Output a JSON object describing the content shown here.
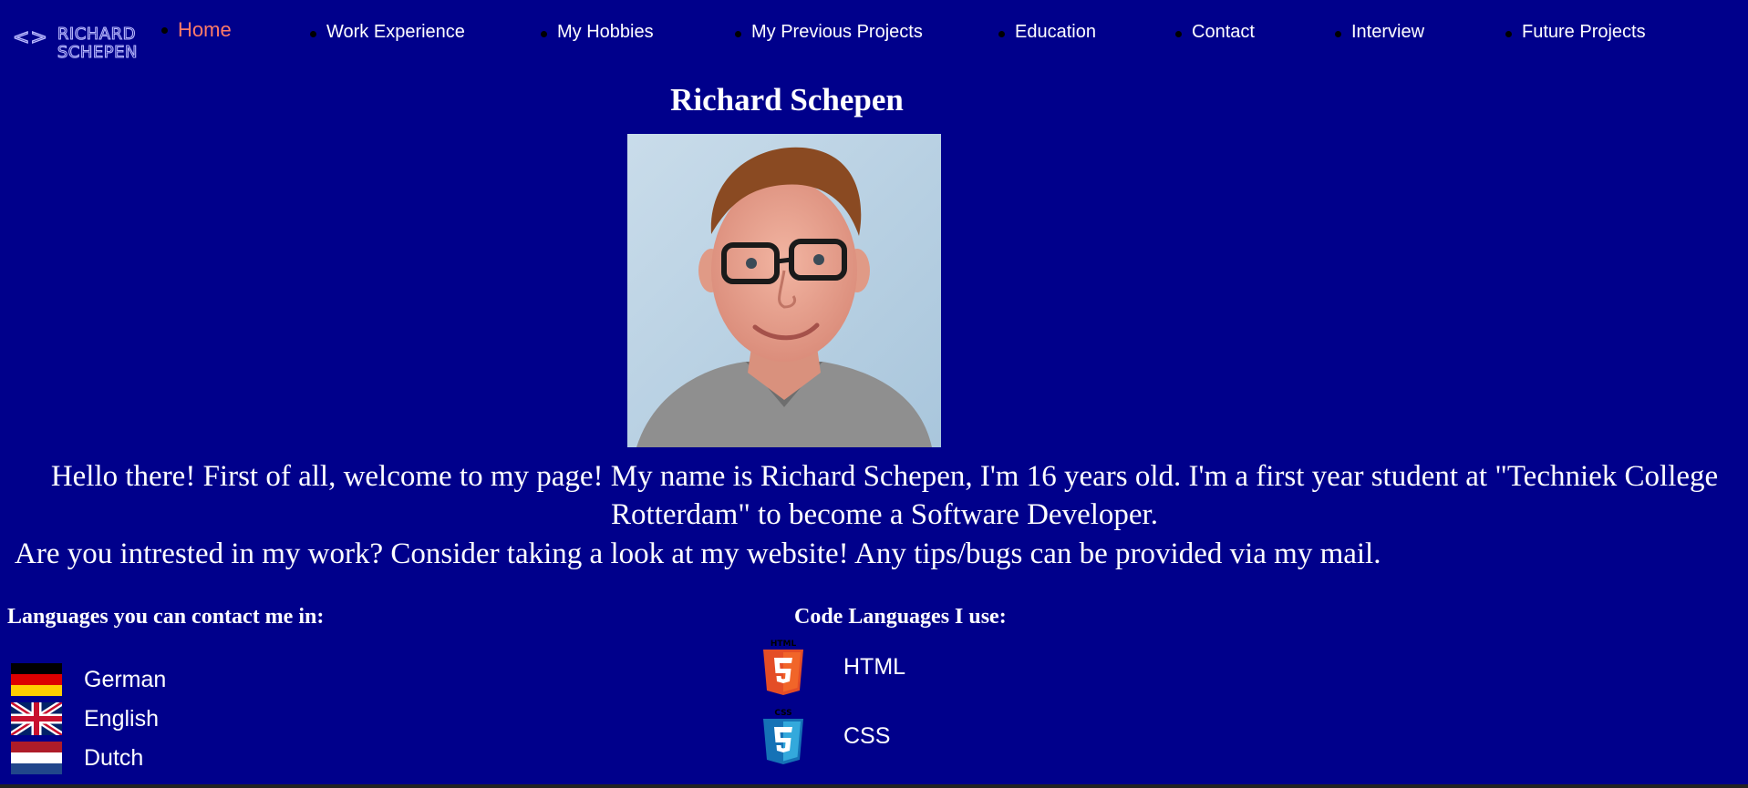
{
  "logo": {
    "code_symbol": "<>",
    "line1": "RICHARD",
    "line2": "SCHEPEN"
  },
  "nav": {
    "items": [
      {
        "label": "Home",
        "active": true
      },
      {
        "label": "Work Experience"
      },
      {
        "label": "My Hobbies"
      },
      {
        "label": "My Previous Projects"
      },
      {
        "label": "Education"
      },
      {
        "label": "Contact"
      },
      {
        "label": "Interview"
      },
      {
        "label": "Future Projects"
      }
    ]
  },
  "main": {
    "title": "Richard Schepen",
    "intro": "Hello there! First of all, welcome to my page! My name is Richard Schepen, I'm 16 years old. I'm a first year student at \"Techniek College Rotterdam\" to become a Software Developer.",
    "intro2": "Are you intrested in my work? Consider taking a look at my website! Any tips/bugs can be provided via my mail."
  },
  "languages": {
    "heading": "Languages you can contact me in:",
    "items": [
      {
        "label": "German",
        "icon": "german-flag-icon"
      },
      {
        "label": "English",
        "icon": "uk-flag-icon"
      },
      {
        "label": "Dutch",
        "icon": "dutch-flag-icon"
      }
    ]
  },
  "code_languages": {
    "heading": "Code Languages I use:",
    "items": [
      {
        "label": "HTML",
        "badge": "HTML",
        "icon": "html5-icon"
      },
      {
        "label": "CSS",
        "badge": "CSS",
        "icon": "css3-icon"
      }
    ]
  },
  "colors": {
    "background": "#00008b",
    "nav_active": "#ff7b68",
    "text": "#ffffff",
    "html5": "#e44d26",
    "css3": "#1572b6"
  }
}
